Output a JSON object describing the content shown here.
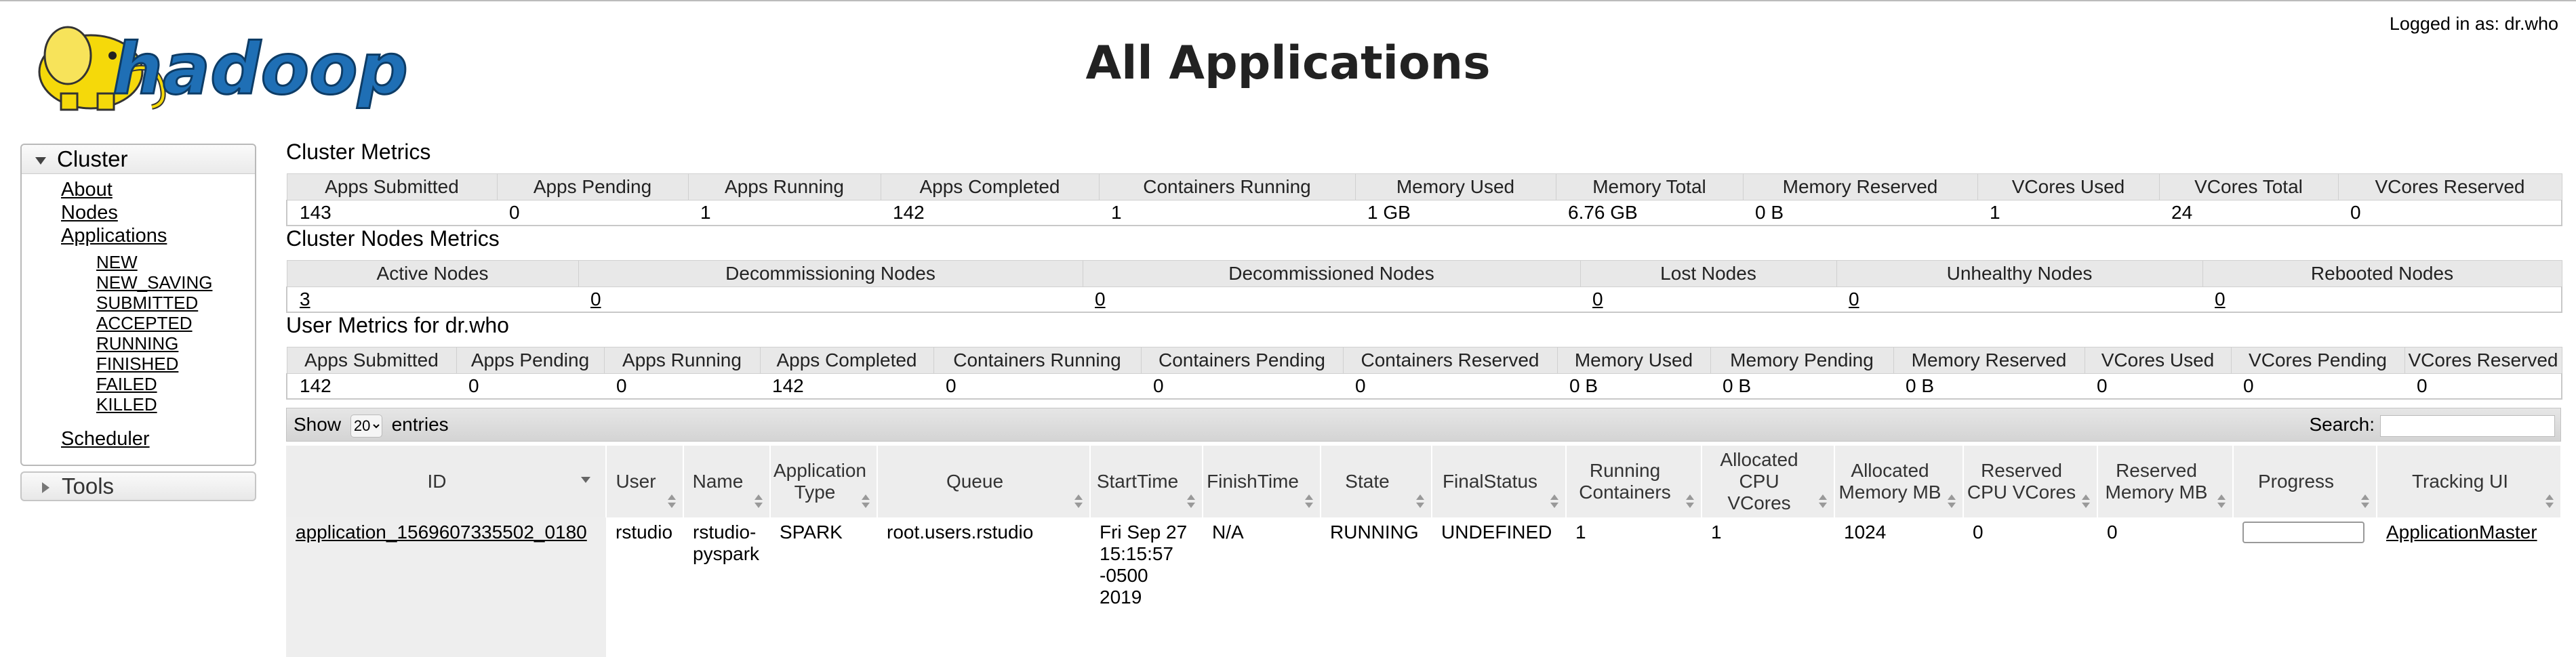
{
  "header": {
    "title": "All Applications",
    "logged_in": "Logged in as: dr.who",
    "logo_text": "hadoop"
  },
  "nav": {
    "cluster_label": "Cluster",
    "links": [
      "About",
      "Nodes",
      "Applications"
    ],
    "app_states": [
      "NEW",
      "NEW_SAVING",
      "SUBMITTED",
      "ACCEPTED",
      "RUNNING",
      "FINISHED",
      "FAILED",
      "KILLED"
    ],
    "scheduler": "Scheduler",
    "tools_label": "Tools"
  },
  "cluster_metrics": {
    "title": "Cluster Metrics",
    "headers": [
      "Apps Submitted",
      "Apps Pending",
      "Apps Running",
      "Apps Completed",
      "Containers Running",
      "Memory Used",
      "Memory Total",
      "Memory Reserved",
      "VCores Used",
      "VCores Total",
      "VCores Reserved"
    ],
    "values": [
      "143",
      "0",
      "1",
      "142",
      "1",
      "1 GB",
      "6.76 GB",
      "0 B",
      "1",
      "24",
      "0"
    ]
  },
  "node_metrics": {
    "title": "Cluster Nodes Metrics",
    "headers": [
      "Active Nodes",
      "Decommissioning Nodes",
      "Decommissioned Nodes",
      "Lost Nodes",
      "Unhealthy Nodes",
      "Rebooted Nodes"
    ],
    "values": [
      "3",
      "0",
      "0",
      "0",
      "0",
      "0"
    ]
  },
  "user_metrics": {
    "title": "User Metrics for dr.who",
    "headers": [
      "Apps Submitted",
      "Apps Pending",
      "Apps Running",
      "Apps Completed",
      "Containers Running",
      "Containers Pending",
      "Containers Reserved",
      "Memory Used",
      "Memory Pending",
      "Memory Reserved",
      "VCores Used",
      "VCores Pending",
      "VCores Reserved"
    ],
    "values": [
      "142",
      "0",
      "0",
      "142",
      "0",
      "0",
      "0",
      "0 B",
      "0 B",
      "0 B",
      "0",
      "0",
      "0"
    ]
  },
  "apps": {
    "show_label": "Show",
    "entries_label": "entries",
    "page_size": "20",
    "search_label": "Search:",
    "headers": [
      "ID",
      "User",
      "Name",
      "Application Type",
      "Queue",
      "StartTime",
      "FinishTime",
      "State",
      "FinalStatus",
      "Running Containers",
      "Allocated CPU VCores",
      "Allocated Memory MB",
      "Reserved CPU VCores",
      "Reserved Memory MB",
      "Progress",
      "Tracking UI"
    ],
    "rows": [
      {
        "id": "application_1569607335502_0180",
        "user": "rstudio",
        "name": "rstudio-pyspark",
        "type": "SPARK",
        "queue": "root.users.rstudio",
        "start": "Fri Sep 27 15:15:57 -0500 2019",
        "finish": "N/A",
        "state": "RUNNING",
        "final_status": "UNDEFINED",
        "running_containers": "1",
        "alloc_vcores": "1",
        "alloc_mem": "1024",
        "res_vcores": "0",
        "res_mem": "0",
        "progress": 0,
        "tracking": "ApplicationMaster"
      }
    ]
  },
  "colors": {
    "header_bg": "#e8e8e8",
    "progress_fill": "#3f9e3f",
    "elephant": "#f5d90a",
    "logo_blue": "#1f6fb5"
  }
}
